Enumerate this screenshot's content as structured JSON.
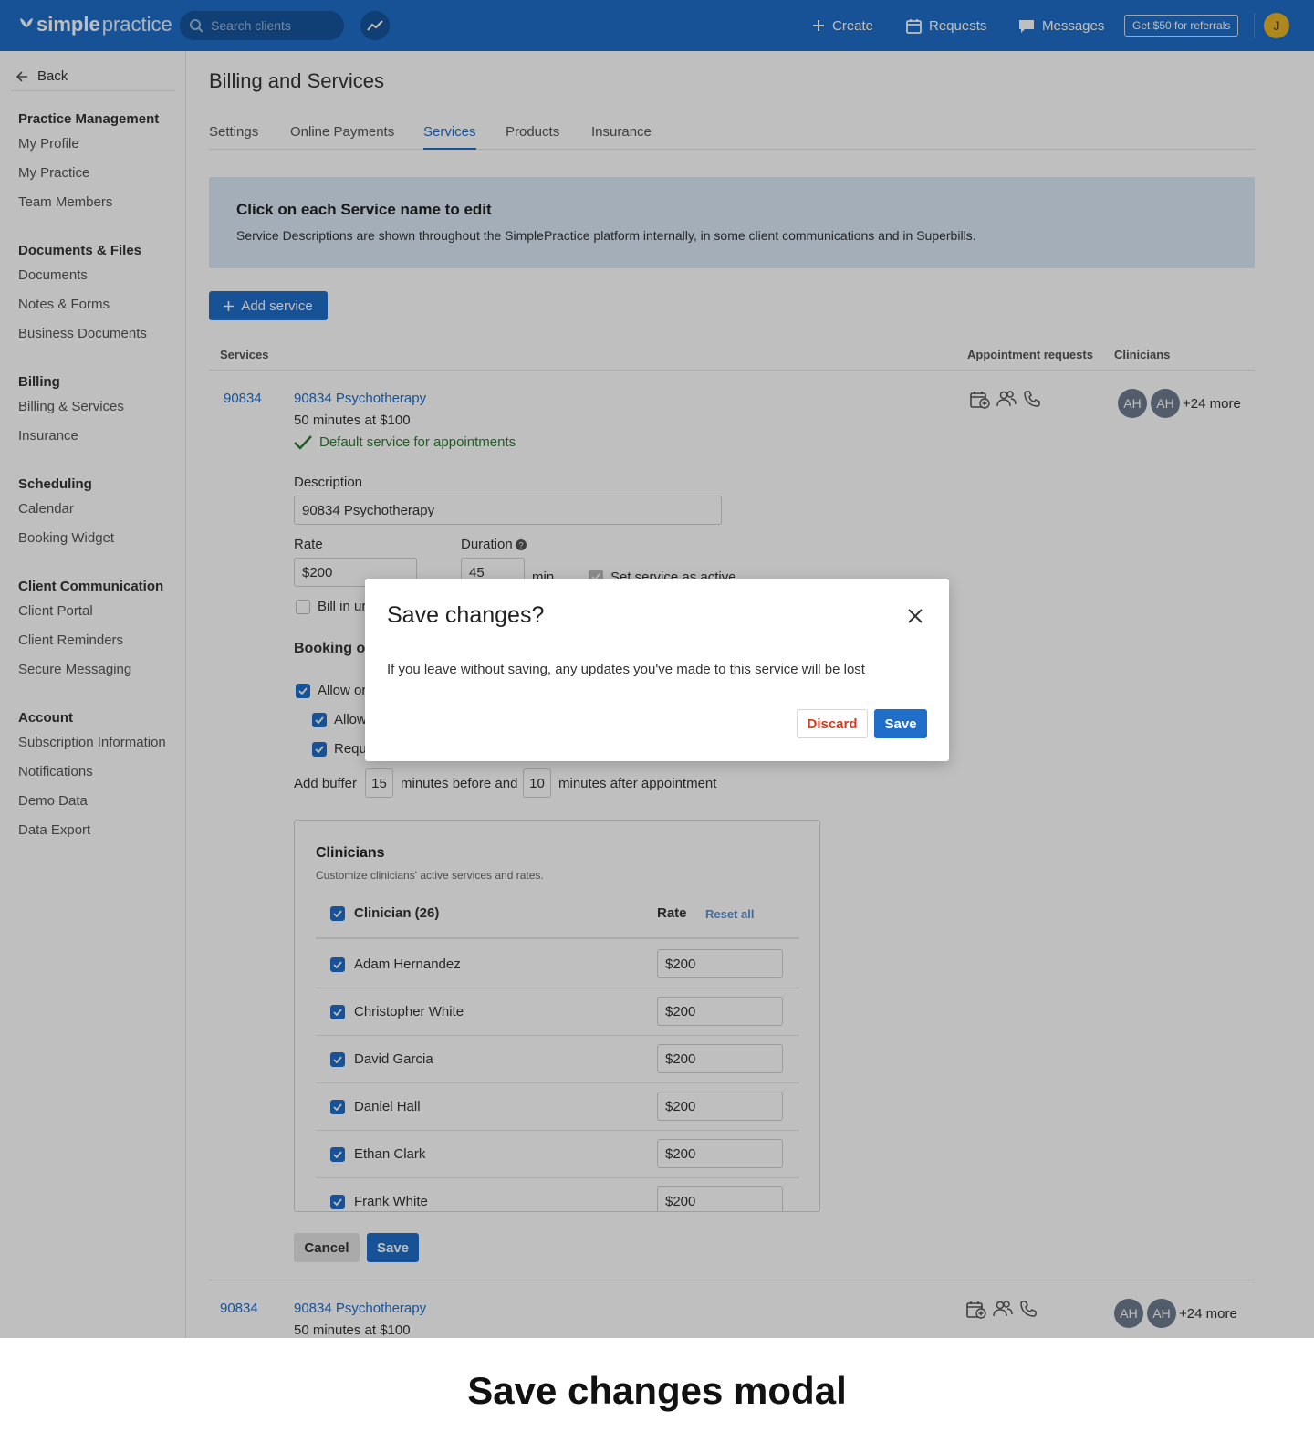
{
  "topbar": {
    "logo_bold": "simple",
    "logo_light": "practice",
    "search_placeholder": "Search clients",
    "create": "Create",
    "requests": "Requests",
    "messages": "Messages",
    "referral": "Get $50 for referrals",
    "avatar_initial": "J",
    "brand_color": "#1f6ec9"
  },
  "sidebar": {
    "back": "Back",
    "groups": [
      {
        "title": "Practice Management",
        "items": [
          "My Profile",
          "My Practice",
          "Team Members"
        ]
      },
      {
        "title": "Documents & Files",
        "items": [
          "Documents",
          "Notes & Forms",
          "Business Documents"
        ]
      },
      {
        "title": "Billing",
        "items": [
          "Billing & Services",
          "Insurance"
        ]
      },
      {
        "title": "Scheduling",
        "items": [
          "Calendar",
          "Booking Widget"
        ]
      },
      {
        "title": "Client Communication",
        "items": [
          "Client Portal",
          "Client Reminders",
          "Secure Messaging"
        ]
      },
      {
        "title": "Account",
        "items": [
          "Subscription Information",
          "Notifications",
          "Demo Data",
          "Data Export"
        ]
      }
    ]
  },
  "main": {
    "title": "Billing and Services",
    "tabs": [
      "Settings",
      "Online Payments",
      "Services",
      "Products",
      "Insurance"
    ],
    "active_tab": "Services",
    "banner_title": "Click on each Service name to edit",
    "banner_desc": "Service Descriptions are shown throughout the SimplePractice platform internally, in some client communications and in Superbills.",
    "add_service": "Add service",
    "columns": {
      "services": "Services",
      "appointment_requests": "Appointment requests",
      "clinicians": "Clinicians"
    }
  },
  "service": {
    "code": "90834",
    "name": "90834 Psychotherapy",
    "summary": "50 minutes at $100",
    "default_note": "Default service for appointments",
    "avatars": [
      "AH",
      "AH"
    ],
    "more": "+24 more",
    "description_label": "Description",
    "description_value": "90834 Psychotherapy",
    "rate_label": "Rate",
    "rate_value": "$200",
    "duration_label": "Duration",
    "duration_value": "45",
    "duration_unit": "min",
    "set_active": "Set service as active",
    "bill_units": "Bill in ur",
    "booking_heading": "Booking o",
    "allow_online": "Allow or",
    "allow_sub": "Allow",
    "require_sub": "Requ",
    "buffer_prefix": "Add buffer",
    "buffer_before": "15",
    "buffer_mid": "minutes before and",
    "buffer_after": "10",
    "buffer_suffix": "minutes after appointment"
  },
  "clinicians": {
    "title": "Clinicians",
    "subtitle": "Customize clinicians' active services and rates.",
    "header_label": "Clinician (26)",
    "rate_label": "Rate",
    "reset_all": "Reset all",
    "rows": [
      {
        "name": "Adam Hernandez",
        "rate": "$200"
      },
      {
        "name": "Christopher White",
        "rate": "$200"
      },
      {
        "name": "David Garcia",
        "rate": "$200"
      },
      {
        "name": "Daniel Hall",
        "rate": "$200"
      },
      {
        "name": "Ethan Clark",
        "rate": "$200"
      },
      {
        "name": "Frank White",
        "rate": "$200"
      }
    ]
  },
  "form_actions": {
    "cancel": "Cancel",
    "save": "Save"
  },
  "service2": {
    "code": "90834",
    "name": "90834 Psychotherapy",
    "summary": "50 minutes at $100",
    "avatars": [
      "AH",
      "AH"
    ],
    "more": "+24 more"
  },
  "modal": {
    "title": "Save changes?",
    "body": "If you leave without saving, any updates you've made to this service will be lost",
    "discard": "Discard",
    "save": "Save"
  },
  "caption": "Save changes modal"
}
